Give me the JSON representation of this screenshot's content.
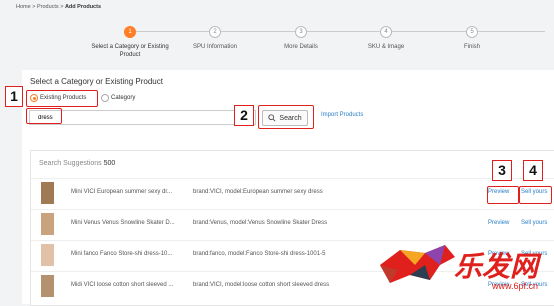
{
  "breadcrumb": {
    "home": "Home",
    "sep": ">",
    "products": "Products",
    "current": "Add Products"
  },
  "steps": [
    {
      "num": "1",
      "label": "Select a Category or Existing Product"
    },
    {
      "num": "2",
      "label": "SPU Information"
    },
    {
      "num": "3",
      "label": "More Details"
    },
    {
      "num": "4",
      "label": "SKU & Image"
    },
    {
      "num": "5",
      "label": "Finish"
    }
  ],
  "section_title": "Select a Category or Existing Product",
  "radios": {
    "existing": "Existing Products",
    "category": "Category"
  },
  "search": {
    "value": "dress",
    "button": "Search",
    "import_link": "Import Products"
  },
  "suggestions": {
    "label": "Search Suggestions",
    "count": "500",
    "rows": [
      {
        "name": "Mini VICI European summer sexy dr...",
        "brand": "brand:VICI, model:European summer sexy dress",
        "preview": "Preview",
        "sell": "Sell yours"
      },
      {
        "name": "Mini Venus Venus Snowline Skater D...",
        "brand": "brand:Venus, model:Venus Snowline Skater Dress",
        "preview": "Preview",
        "sell": "Sell yours"
      },
      {
        "name": "Mini fanco Fanco Store-shi dress-10...",
        "brand": "brand:fanco, model:Fanco Store-shi dress-1001-5",
        "preview": "Preview",
        "sell": "Sell yours"
      },
      {
        "name": "Midi VICI loose cotton short sleeved ...",
        "brand": "brand:VICI, model:loose cotton short sleeved dress",
        "preview": "Preview",
        "sell": "Sell yours"
      }
    ]
  },
  "callouts": [
    "1",
    "2",
    "3",
    "4"
  ],
  "watermark": {
    "text": "乐发网",
    "url": "www.6pf.cn"
  },
  "colors": {
    "accent": "#ff7e27",
    "link": "#2a7ec7",
    "callout": "#e0201c"
  }
}
